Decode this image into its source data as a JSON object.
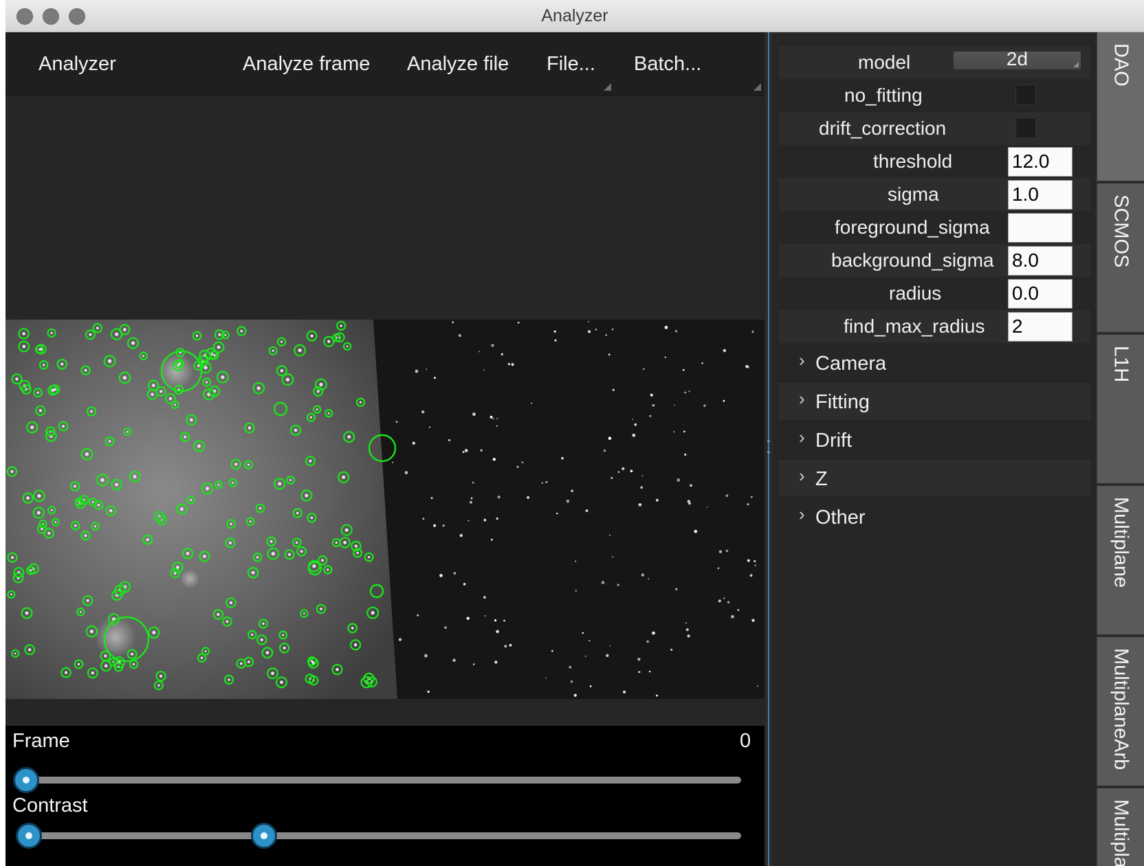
{
  "window": {
    "title": "Analyzer"
  },
  "toolbar": {
    "title": "Analyzer",
    "analyze_frame": "Analyze frame",
    "analyze_file": "Analyze file",
    "file_menu": "File...",
    "batch_menu": "Batch..."
  },
  "controls": {
    "frame_label": "Frame",
    "frame_value": "0",
    "frame_position": 0.0,
    "contrast_label": "Contrast",
    "contrast_low": 0.0,
    "contrast_high": 0.33
  },
  "params": {
    "model": {
      "label": "model",
      "value": "2d"
    },
    "no_fitting": {
      "label": "no_fitting",
      "checked": false
    },
    "drift_correction": {
      "label": "drift_correction",
      "checked": false
    },
    "threshold": {
      "label": "threshold",
      "value": "12.0"
    },
    "sigma": {
      "label": "sigma",
      "value": "1.0"
    },
    "foreground_sigma": {
      "label": "foreground_sigma",
      "value": ""
    },
    "background_sigma": {
      "label": "background_sigma",
      "value": "8.0"
    },
    "radius": {
      "label": "radius",
      "value": "0.0"
    },
    "find_max_radius": {
      "label": "find_max_radius",
      "value": "2"
    }
  },
  "groups": [
    "Camera",
    "Fitting",
    "Drift",
    "Z",
    "Other"
  ],
  "tabs": [
    "DAO",
    "SCMOS",
    "L1H",
    "Multiplane",
    "MultiplaneArb",
    "Multipla"
  ],
  "active_tab": "DAO",
  "colors": {
    "detection_marker": "#19e619",
    "slider_handle": "#2c92c8",
    "splitter": "#3f7fb2"
  },
  "icons": {
    "group_expand": "chevron-right-icon"
  }
}
